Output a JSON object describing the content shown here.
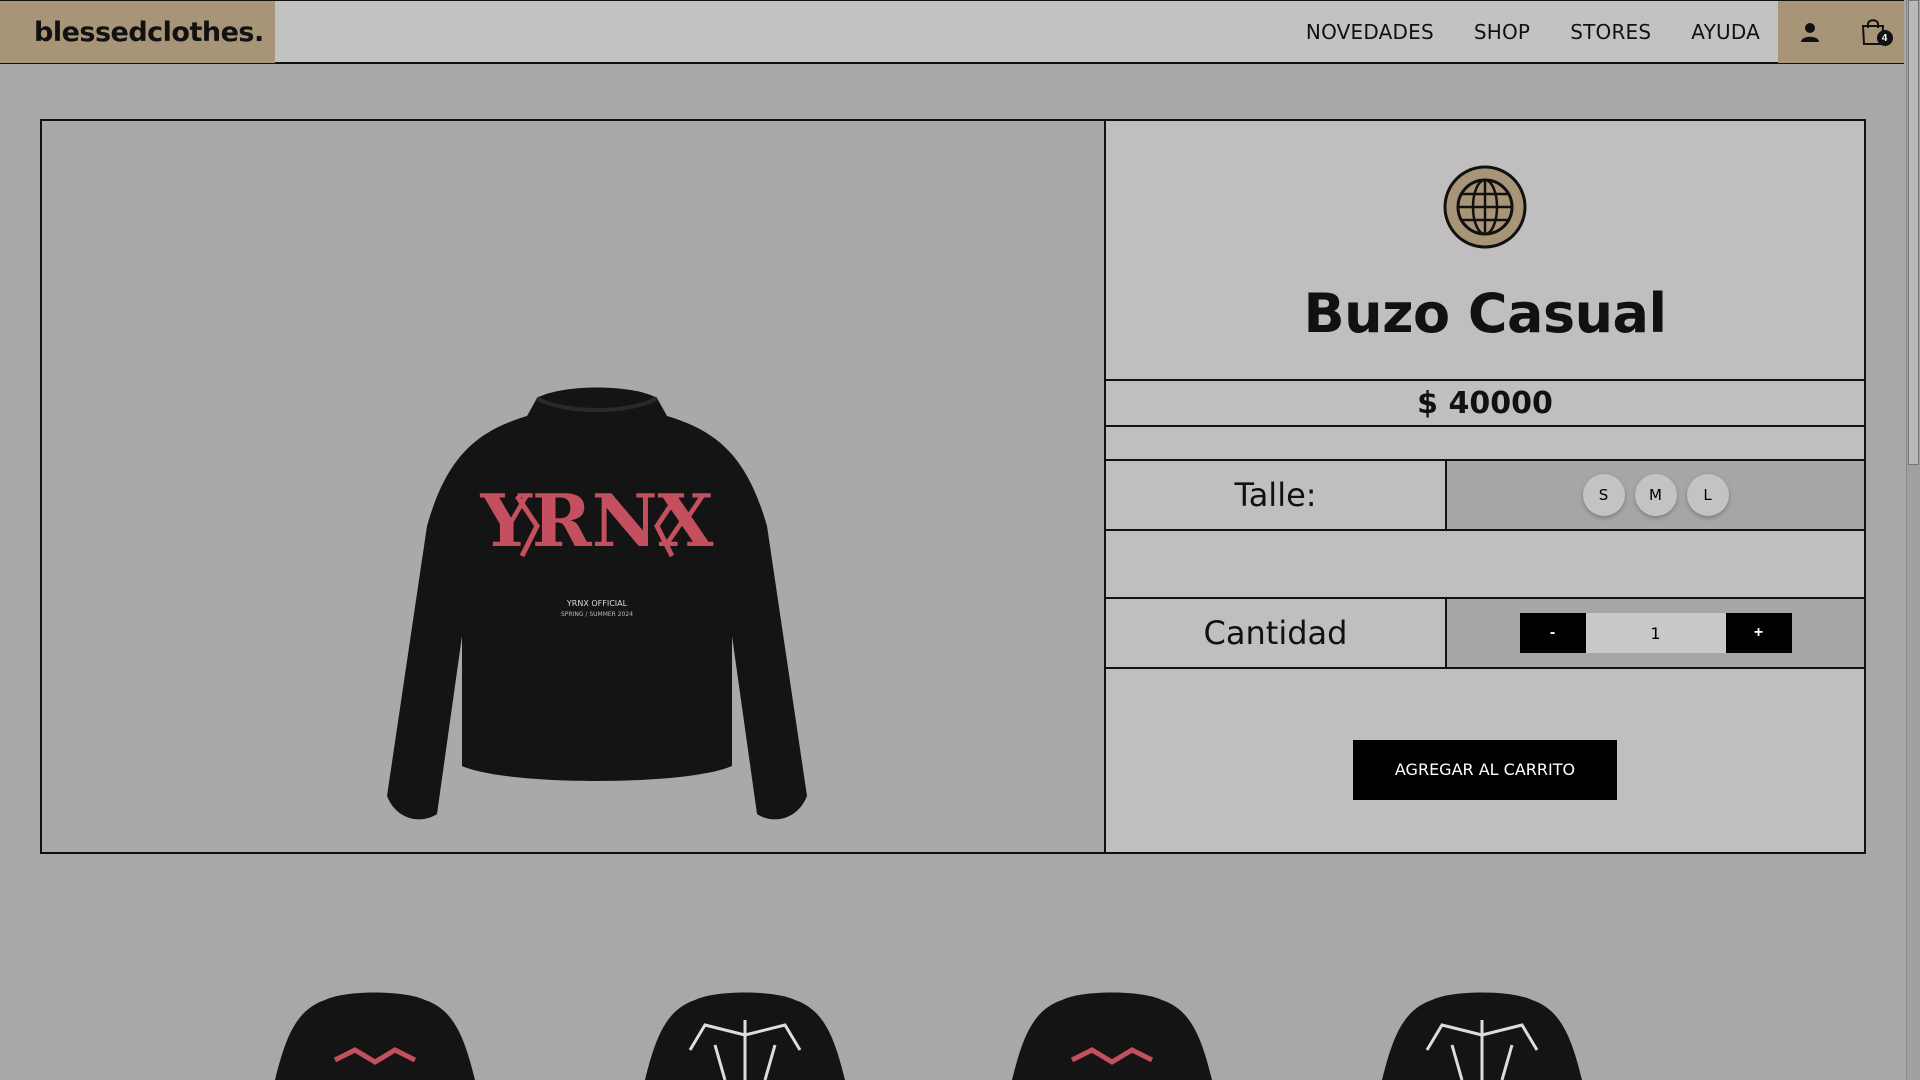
{
  "header": {
    "brand": "blessedclothes.",
    "nav": [
      "NOVEDADES",
      "SHOP",
      "STORES",
      "AYUDA"
    ],
    "cart_count": "4",
    "icons": [
      "user-icon",
      "shopping-bag-icon"
    ]
  },
  "product": {
    "title": "Buzo Casual",
    "price": "$ 40000",
    "size_label": "Talle:",
    "sizes": [
      "S",
      "M",
      "L"
    ],
    "quantity_label": "Cantidad",
    "quantity_value": "1",
    "decrement_label": "-",
    "increment_label": "+",
    "add_to_cart": "AGREGAR AL CARRITO",
    "image_print_text": "YRNX",
    "image_caption": "YRNX OFFICIAL",
    "image_subcaption": "SPRING / SUMMER 2024"
  },
  "colors": {
    "header_bg": "#c2c2c2",
    "accent_tan": "#a89578",
    "page_bg": "#a8a8a8",
    "print_pink": "#c4505f"
  }
}
